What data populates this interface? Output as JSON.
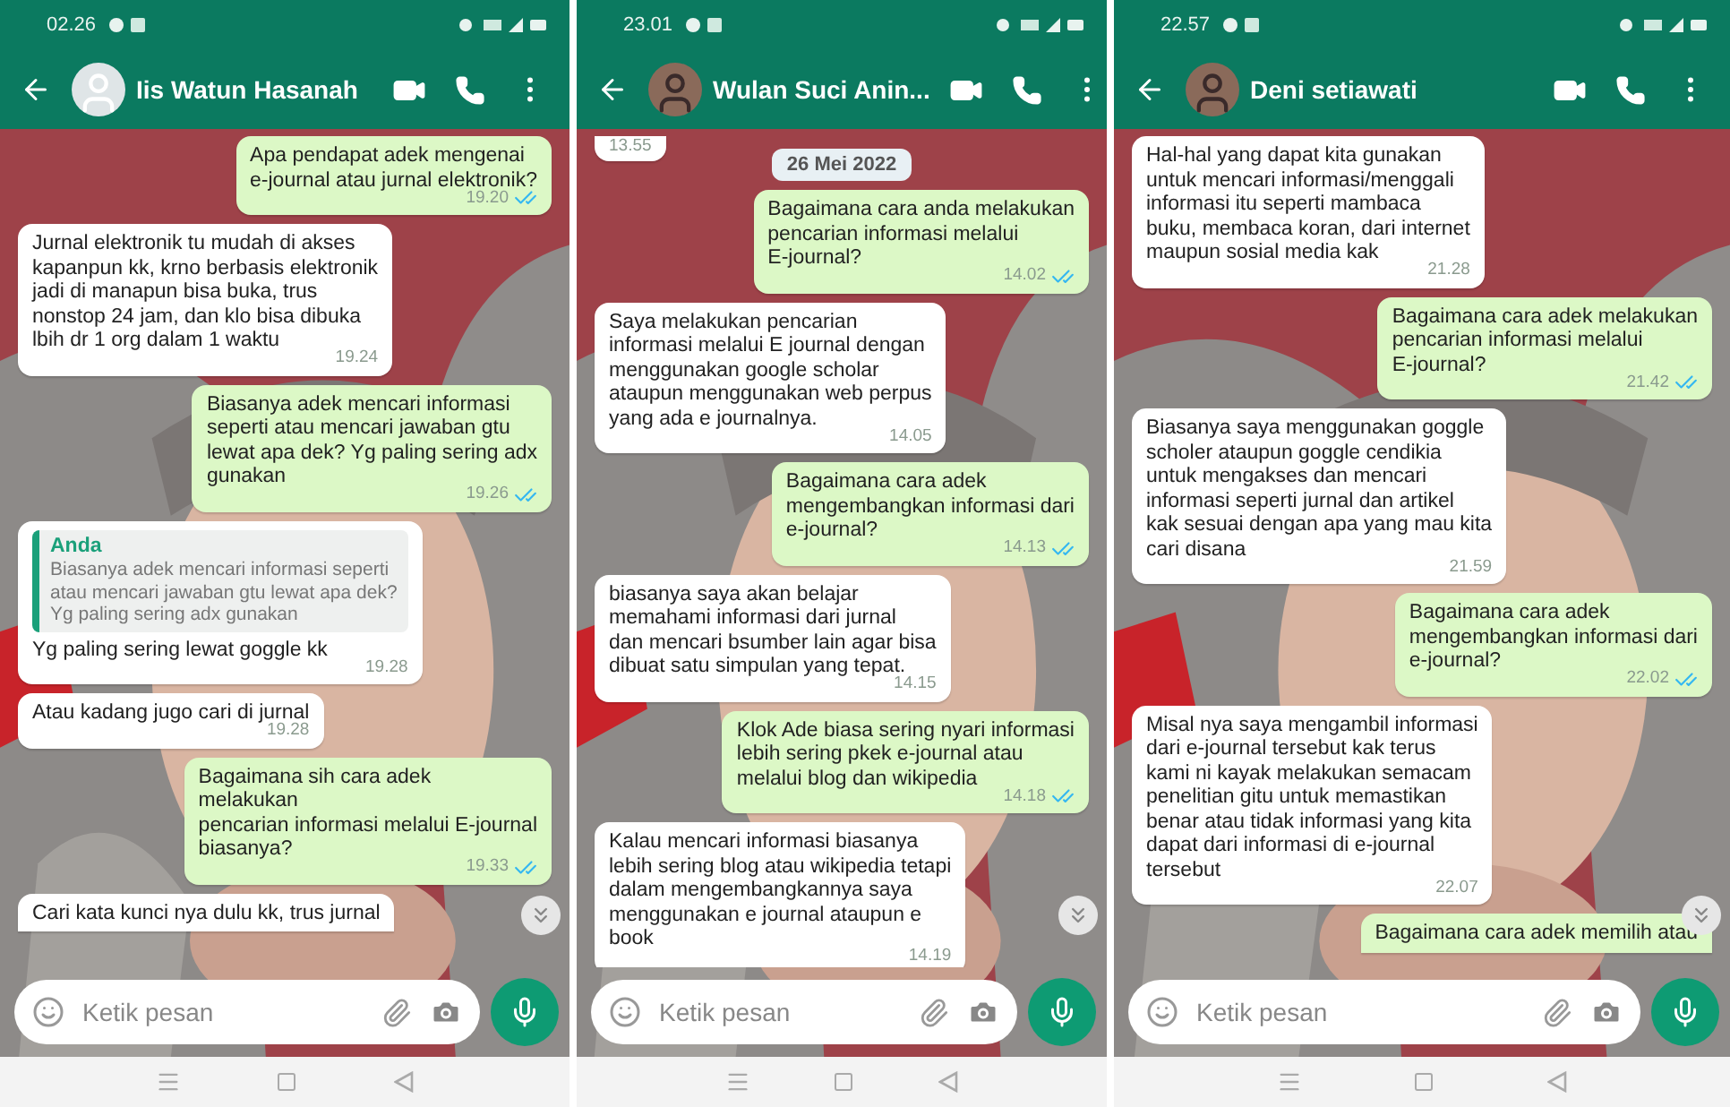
{
  "panels": [
    {
      "status_time": "02.26",
      "contact": {
        "name": "Iis Watun Hasanah",
        "photo": false
      },
      "input": {
        "placeholder": "Ketik pesan"
      },
      "messages": [
        {
          "kind": "out",
          "text": "Apa pendapat adek  mengenai\ne-journal atau jurnal elektronik?",
          "time": "19.20",
          "read": true
        },
        {
          "kind": "in",
          "text": "Jurnal elektronik tu mudah di akses\nkapanpun kk, krno berbasis elektronik\njadi di manapun bisa buka, trus\nnonstop 24 jam, dan klo bisa dibuka\nlbih dr 1 org dalam 1 waktu",
          "time": "19.24"
        },
        {
          "kind": "out",
          "text": "Biasanya adek mencari informasi\nseperti atau mencari jawaban gtu\nlewat apa dek? Yg paling sering adx\ngunakan",
          "time": "19.26",
          "read": true
        },
        {
          "kind": "in",
          "quote": {
            "author": "Anda",
            "text": "Biasanya adek mencari informasi seperti\natau mencari jawaban gtu lewat apa dek?\nYg paling sering adx gunakan"
          },
          "text": "Yg paling sering lewat goggle kk",
          "time": "19.28"
        },
        {
          "kind": "in",
          "text": "Atau kadang jugo cari di jurnal",
          "time": "19.28"
        },
        {
          "kind": "out",
          "text": "Bagaimana sih cara adek\nmelakukan\npencarian informasi melalui E-journal\nbiasanya?",
          "time": "19.33",
          "read": true
        },
        {
          "kind": "in",
          "text": "Cari kata kunci nya dulu kk, trus jurnal"
        }
      ]
    },
    {
      "status_time": "23.01",
      "contact": {
        "name": "Wulan Suci Anin...",
        "photo": true
      },
      "input": {
        "placeholder": "Ketik pesan"
      },
      "messages": [
        {
          "kind": "in",
          "time": "13.55"
        },
        {
          "kind": "date",
          "text": "26 Mei 2022"
        },
        {
          "kind": "out",
          "text": "Bagaimana cara anda melakukan\npencarian informasi melalui\nE-journal?",
          "time": "14.02",
          "read": true
        },
        {
          "kind": "in",
          "text": "Saya melakukan pencarian\ninformasi melalui E journal dengan\nmenggunakan google scholar\nataupun menggunakan web perpus\nyang ada e journalnya.",
          "time": "14.05"
        },
        {
          "kind": "out",
          "text": "Bagaimana cara adek\nmengembangkan informasi dari\ne-journal?",
          "time": "14.13",
          "read": true
        },
        {
          "kind": "in",
          "text": "biasanya saya akan belajar\nmemahami informasi dari jurnal\ndan mencari bsumber lain agar bisa\ndibuat satu simpulan yang tepat.",
          "time": "14.15"
        },
        {
          "kind": "out",
          "text": "Klok Ade biasa sering nyari informasi\nlebih sering pkek e-journal atau\nmelalui blog dan wikipedia",
          "time": "14.18",
          "read": true
        },
        {
          "kind": "in",
          "text": "Kalau mencari informasi biasanya\nlebih sering blog atau wikipedia tetapi\ndalam mengembangkannya saya\nmenggunakan e journal ataupun e\nbook",
          "time": "14.19"
        }
      ]
    },
    {
      "status_time": "22.57",
      "contact": {
        "name": "Deni setiawati",
        "photo": true
      },
      "input": {
        "placeholder": "Ketik pesan"
      },
      "messages": [
        {
          "kind": "in",
          "text": "Hal-hal yang dapat kita gunakan\nuntuk mencari informasi/menggali\ninformasi itu seperti mambaca\nbuku, membaca koran, dari internet\nmaupun sosial media kak",
          "time": "21.28"
        },
        {
          "kind": "out",
          "text": "Bagaimana cara adek melakukan\npencarian informasi melalui\nE-journal?",
          "time": "21.42",
          "read": true
        },
        {
          "kind": "in",
          "text": "Biasanya saya menggunakan goggle\nscholer ataupun goggle cendikia\nuntuk mengakses dan mencari\ninformasi seperti jurnal dan artikel\nkak sesuai dengan apa yang mau kita\ncari disana",
          "time": "21.59"
        },
        {
          "kind": "out",
          "text": "Bagaimana cara adek\nmengembangkan informasi dari\ne-journal?",
          "time": "22.02",
          "read": true
        },
        {
          "kind": "in",
          "text": "Misal nya saya mengambil informasi\ndari e-journal tersebut kak terus\nkami ni kayak melakukan semacam\npenelitian gitu untuk memastikan\nbenar atau tidak informasi yang kita\ndapat dari informasi di e-journal\ntersebut",
          "time": "22.07"
        },
        {
          "kind": "out",
          "text": "Bagaimana cara adek memilih atau"
        }
      ]
    }
  ]
}
